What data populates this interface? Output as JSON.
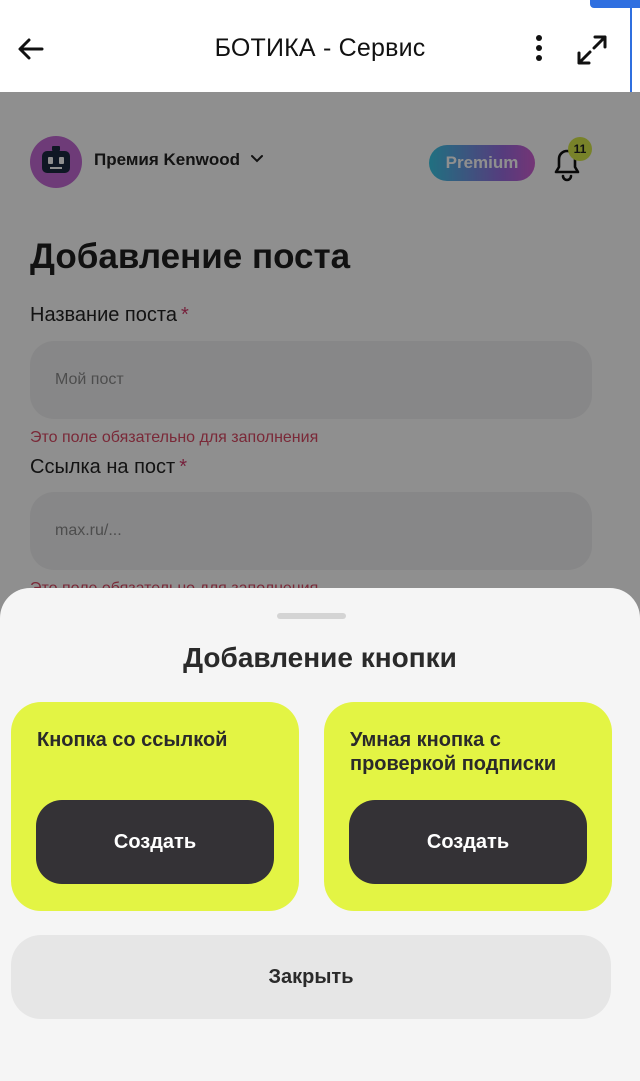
{
  "appbar": {
    "title": "БОТИКА - Сервис",
    "back_icon": "arrow-left-icon",
    "menu_icon": "more-vertical-icon",
    "expand_icon": "expand-diagonal-icon"
  },
  "account": {
    "name": "Премия Kenwood",
    "avatar_icon": "robot-icon",
    "plan_badge": "Premium",
    "notifications_count": "11"
  },
  "page": {
    "title": "Добавление поста",
    "fields": [
      {
        "label": "Название поста",
        "required_mark": "*",
        "placeholder": "Мой пост",
        "error": "Это поле обязательно для заполнения"
      },
      {
        "label": "Ссылка на пост",
        "required_mark": "*",
        "placeholder": "max.ru/...",
        "error": "Это поле обязательно для заполнения"
      }
    ]
  },
  "sheet": {
    "title": "Добавление кнопки",
    "options": [
      {
        "title": "Кнопка со ссылкой",
        "action": "Создать"
      },
      {
        "title": "Умная кнопка с проверкой подписки",
        "action": "Создать"
      }
    ],
    "close_label": "Закрыть"
  },
  "colors": {
    "card_bg": "#e3f444",
    "action_btn_bg": "#343236",
    "error_text": "#d94a64",
    "premium_gradient": [
      "#3ac8e6",
      "#d05fd3"
    ],
    "badge_bg": "#d6e84a"
  }
}
